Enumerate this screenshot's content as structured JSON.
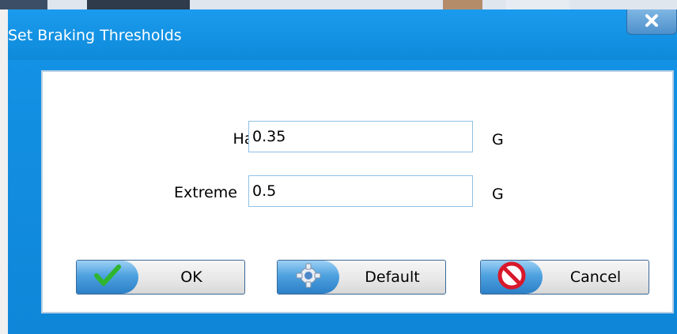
{
  "dialog": {
    "title": "Set Braking Thresholds",
    "close_icon": "close-icon"
  },
  "fields": [
    {
      "label": "Hard",
      "value": "0.35",
      "unit": "G"
    },
    {
      "label": "Extreme",
      "value": "0.5",
      "unit": "G"
    }
  ],
  "buttons": {
    "ok": {
      "label": "OK",
      "icon": "checkmark-icon"
    },
    "default": {
      "label": "Default",
      "icon": "gear-icon"
    },
    "cancel": {
      "label": "Cancel",
      "icon": "no-entry-icon"
    }
  },
  "colors": {
    "titlebar": "#1493e6",
    "button_cap": "#4ea2e0",
    "check_green": "#2fb52f",
    "cancel_red": "#d8182b"
  }
}
